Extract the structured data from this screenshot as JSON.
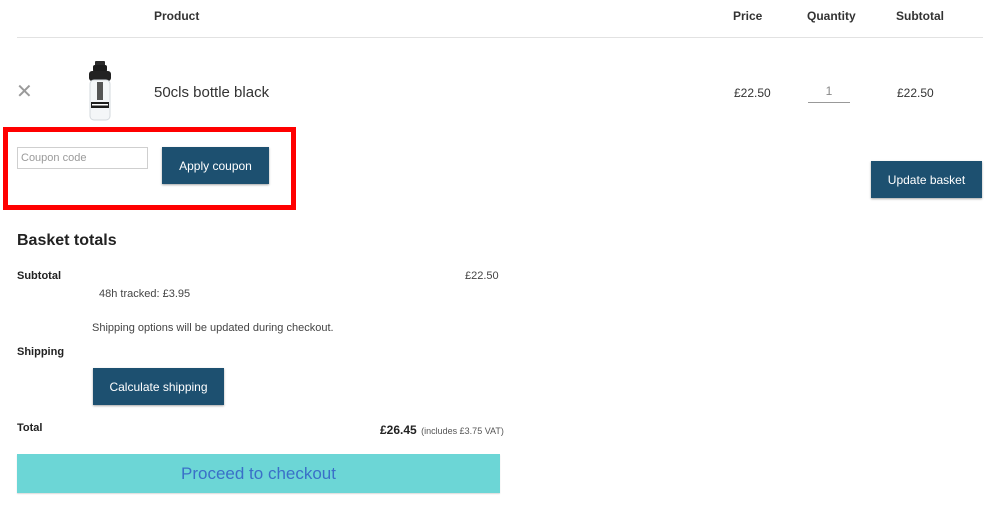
{
  "table": {
    "headers": {
      "product": "Product",
      "price": "Price",
      "quantity": "Quantity",
      "subtotal": "Subtotal"
    },
    "rows": [
      {
        "remove_glyph": "✕",
        "product_name": "50cls bottle black",
        "price": "£22.50",
        "quantity": "1",
        "subtotal": "£22.50"
      }
    ]
  },
  "coupon": {
    "placeholder": "Coupon code",
    "apply_label": "Apply coupon"
  },
  "update_label": "Update basket",
  "totals": {
    "title": "Basket totals",
    "subtotal_label": "Subtotal",
    "subtotal_value": "£22.50",
    "shipping_method": "48h tracked: £3.95",
    "shipping_note": "Shipping options will be updated during checkout.",
    "shipping_label": "Shipping",
    "calculate_label": "Calculate shipping",
    "total_label": "Total",
    "total_value": "£26.45",
    "vat_note": "(includes £3.75 VAT)"
  },
  "checkout_label": "Proceed to checkout",
  "colors": {
    "button": "#1d5070",
    "checkout_bg": "#6cd6d6",
    "checkout_text": "#3a70c8",
    "highlight": "#ff0000"
  }
}
